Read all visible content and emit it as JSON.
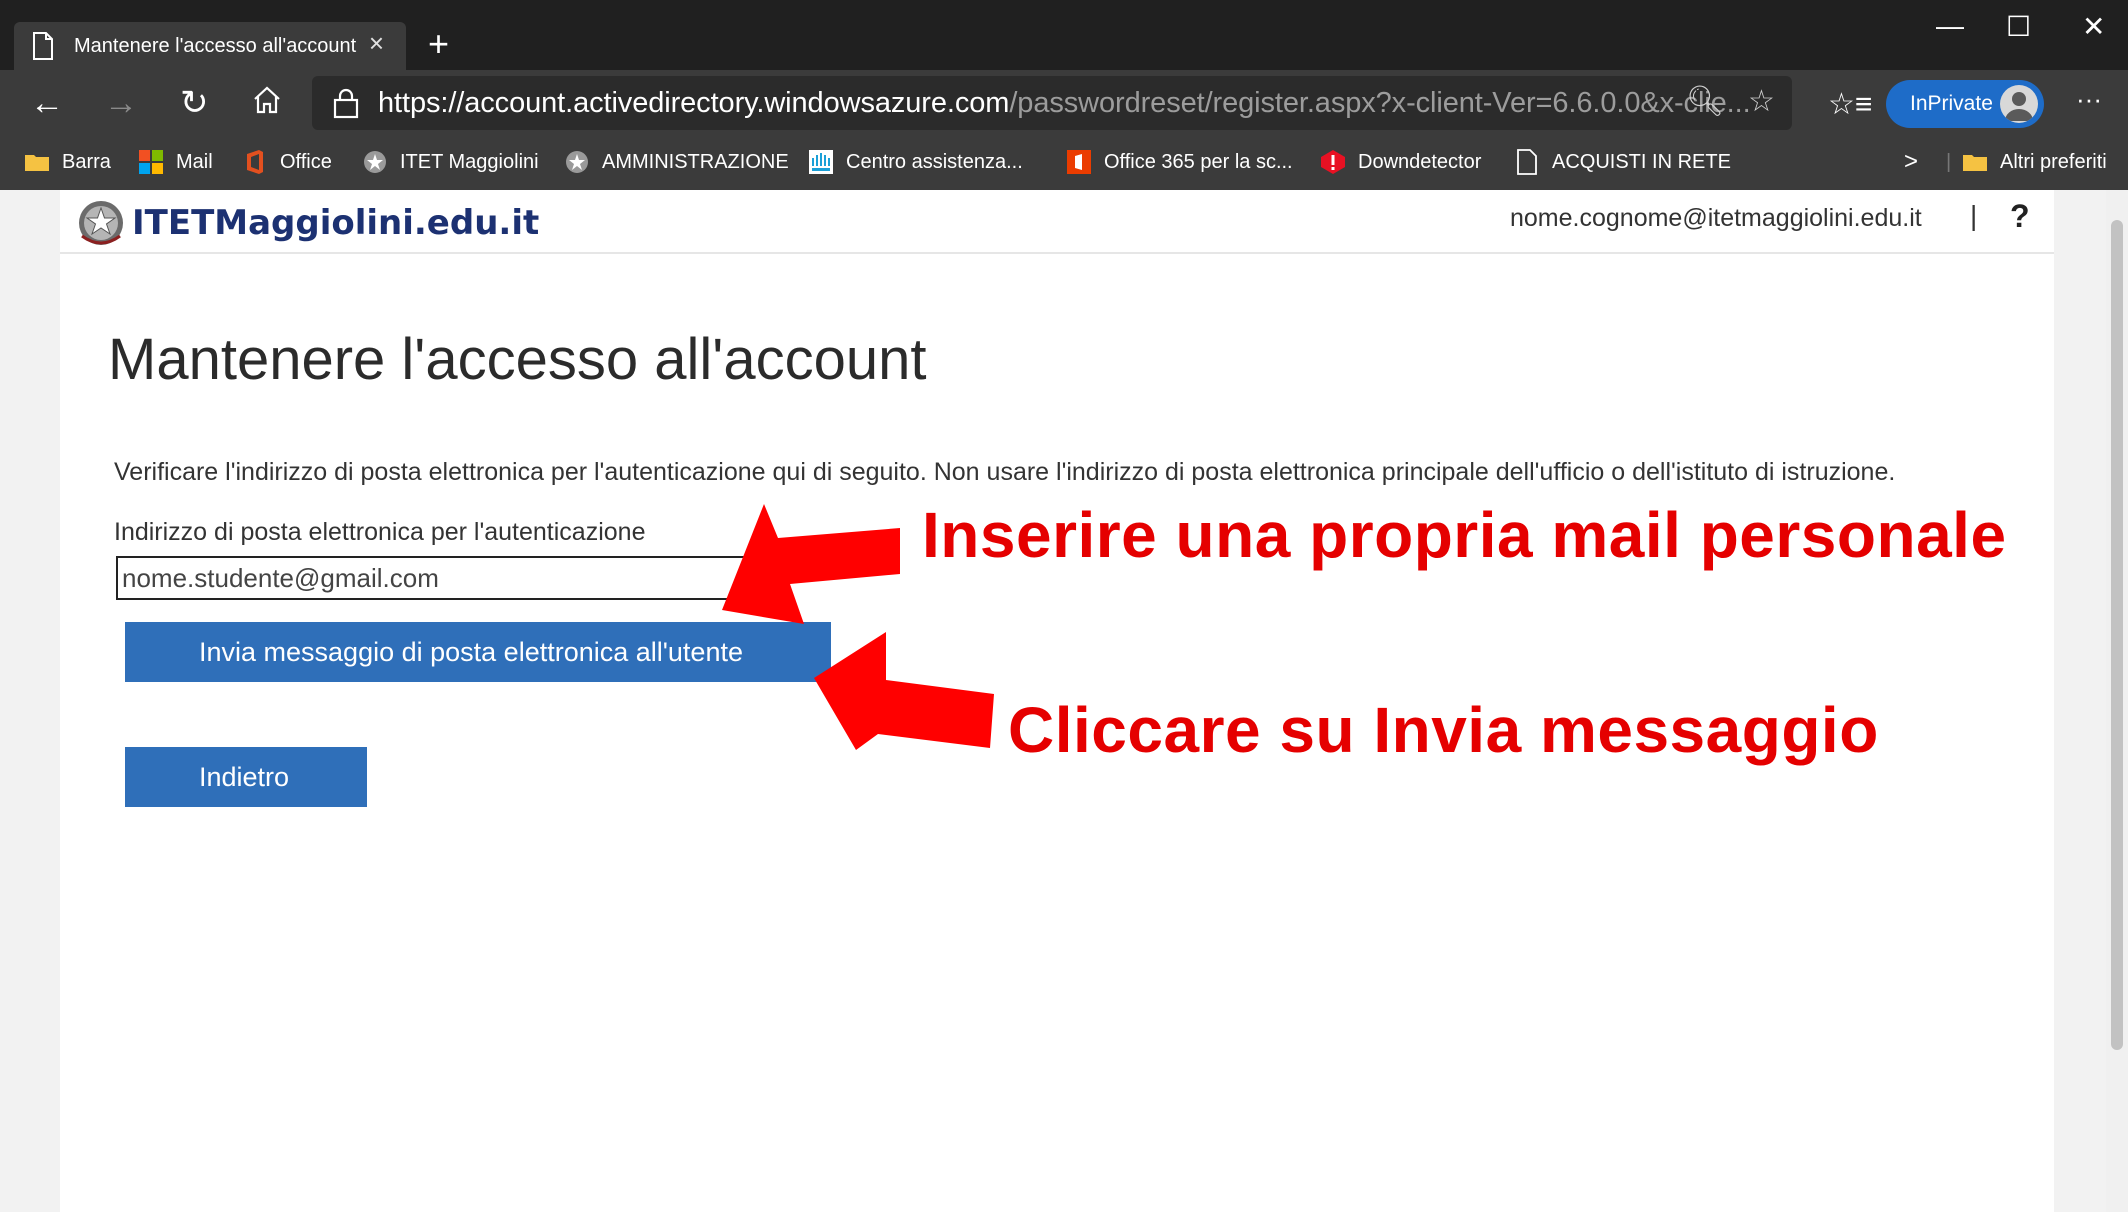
{
  "browser": {
    "tab_title": "Mantenere l'accesso all'account",
    "tab_close": "×",
    "new_tab": "+",
    "window_controls": [
      "—",
      "☐",
      "✕"
    ],
    "url_main": "https://account.activedirectory.windowsazure.com",
    "url_rest": "/passwordreset/register.aspx?x-client-Ver=6.6.0.0&x-clie...",
    "inprivate_label": "InPrivate",
    "more": "···",
    "bookmarks": [
      {
        "label": "Barra",
        "icon": "folder-icon"
      },
      {
        "label": "Mail",
        "icon": "windows-logo-icon"
      },
      {
        "label": "Office",
        "icon": "office-logo-icon"
      },
      {
        "label": "ITET Maggiolini",
        "icon": "emblem-icon"
      },
      {
        "label": "AMMINISTRAZIONE",
        "icon": "emblem-icon"
      },
      {
        "label": "Centro assistenza...",
        "icon": "cisco-icon"
      },
      {
        "label": "Office 365 per la sc...",
        "icon": "office365-icon"
      },
      {
        "label": "Downdetector",
        "icon": "alert-icon"
      },
      {
        "label": "ACQUISTI IN RETE",
        "icon": "page-icon"
      }
    ],
    "other_favorites": "Altri preferiti",
    "chevron": ">"
  },
  "page": {
    "logo_text": "ITETMaggiolini.edu.it",
    "user_email": "nome.cognome@itetmaggiolini.edu.it",
    "separator": "|",
    "help": "?",
    "title": "Mantenere l'accesso all'account",
    "description": "Verificare l'indirizzo di posta elettronica per l'autenticazione qui di seguito. Non usare l'indirizzo di posta elettronica principale dell'ufficio o dell'istituto di istruzione.",
    "field_label": "Indirizzo di posta elettronica per l'autenticazione",
    "email_value": "nome.studente@gmail.com",
    "send_button": "Invia messaggio di posta elettronica all'utente",
    "back_button": "Indietro"
  },
  "annotations": {
    "instruction_1": "Inserire una propria mail personale",
    "instruction_2": "Cliccare su Invia messaggio",
    "color": "#e50000"
  },
  "colors": {
    "button_blue": "#2f6fb9",
    "logo_blue": "#1c3172",
    "inprivate_blue": "#1e6cc8"
  }
}
